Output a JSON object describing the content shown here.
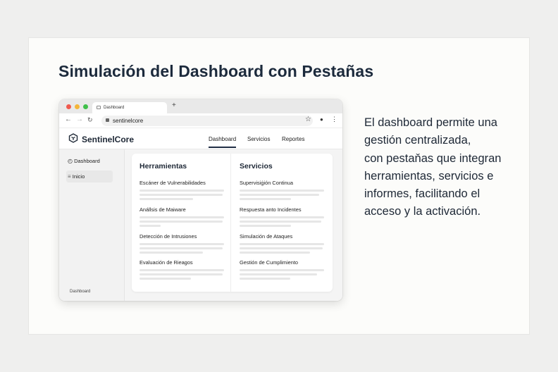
{
  "slide": {
    "title": "Simulación del Dashboard con Pestañas",
    "description_lines": [
      "El dashboard permite una",
      "gestión centralizada,",
      "con pestaňas que integran",
      "herramientas, servicios e",
      "informes, facilitando el",
      "acceso y la activación."
    ]
  },
  "browser": {
    "tab_label": "Dashboard",
    "new_tab": "+",
    "url": "sentinelcore"
  },
  "app": {
    "brand": "SentinelCore",
    "nav_tabs": [
      "Dashboard",
      "Servicios",
      "Reportes"
    ],
    "active_tab": "Dashboard",
    "sidebar": {
      "items": [
        "Dashboard",
        "Inicio"
      ],
      "footer": "Dashboard"
    },
    "columns": [
      {
        "title": "Herramientas",
        "items": [
          "Escáner de Vulnerabilidades",
          "Anállsis de Maiware",
          "Detección de Intrusiones",
          "Evaluación de Rieagos"
        ]
      },
      {
        "title": "Servicios",
        "items": [
          "Supervisiġión Continua",
          "Respuesta anto Incidentes",
          "Simulación de Ataques",
          "Gestión de Cumplimiento"
        ]
      }
    ]
  },
  "colors": {
    "title": "#1c2a3c",
    "active_tab_underline": "#1f2d44",
    "traffic_red": "#f05a4f",
    "traffic_yellow": "#f4b63a",
    "traffic_green": "#3fbf4a"
  }
}
